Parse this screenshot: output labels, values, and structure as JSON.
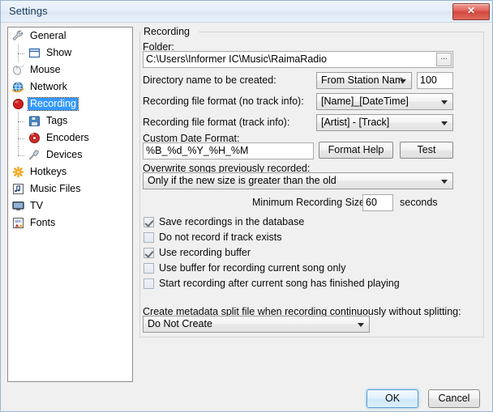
{
  "window": {
    "title": "Settings",
    "close_label": "✕"
  },
  "sidebar": {
    "items": [
      {
        "label": "General",
        "icon": "wrench-icon",
        "level": 0,
        "selected": false
      },
      {
        "label": "Show",
        "icon": "window-icon",
        "level": 1,
        "selected": false
      },
      {
        "label": "Mouse",
        "icon": "mouse-icon",
        "level": 0,
        "selected": false
      },
      {
        "label": "Network",
        "icon": "network-globe-icon",
        "level": 0,
        "selected": false
      },
      {
        "label": "Recording",
        "icon": "record-circle-icon",
        "level": 0,
        "selected": true
      },
      {
        "label": "Tags",
        "icon": "save-disk-icon",
        "level": 1,
        "selected": false
      },
      {
        "label": "Encoders",
        "icon": "disc-icon",
        "level": 1,
        "selected": false
      },
      {
        "label": "Devices",
        "icon": "microphone-icon",
        "level": 1,
        "selected": false
      },
      {
        "label": "Hotkeys",
        "icon": "asterisk-icon",
        "level": 0,
        "selected": false
      },
      {
        "label": "Music Files",
        "icon": "music-note-icon",
        "level": 0,
        "selected": false
      },
      {
        "label": "TV",
        "icon": "monitor-icon",
        "level": 0,
        "selected": false
      },
      {
        "label": "Fonts",
        "icon": "font-abc-icon",
        "level": 0,
        "selected": false
      }
    ]
  },
  "main": {
    "group_title": "Recording",
    "folder": {
      "label": "Folder:",
      "value": "C:\\Users\\Informer IC\\Music\\RaimaRadio",
      "browse_label": "..."
    },
    "directory_name": {
      "label": "Directory name to be created:",
      "selected": "From Station Nam",
      "count_value": "100"
    },
    "format_no_track": {
      "label": "Recording file format (no track info):",
      "selected": "[Name]_[DateTime]"
    },
    "format_track": {
      "label": "Recording file format (track info):",
      "selected": "[Artist] - [Track]"
    },
    "custom_date": {
      "label": "Custom Date Format:",
      "value": "%B_%d_%Y_%H_%M",
      "help_label": "Format Help",
      "test_label": "Test"
    },
    "overwrite": {
      "label": "Overwrite songs previously recorded:",
      "selected": "Only if the new size is greater than the old"
    },
    "minimum_size": {
      "label": "Minimum Recording Size:",
      "value": "60",
      "unit": "seconds"
    },
    "checkboxes": [
      {
        "label": "Save recordings in the database",
        "checked": true
      },
      {
        "label": "Do not record if track exists",
        "checked": false
      },
      {
        "label": "Use recording buffer",
        "checked": true
      },
      {
        "label": "Use buffer for recording current song only",
        "checked": false
      },
      {
        "label": "Start recording after current song has finished playing",
        "checked": false
      }
    ],
    "metadata_split": {
      "label": "Create metadata split file when recording continuously without splitting:",
      "selected": "Do Not Create"
    }
  },
  "footer": {
    "ok_label": "OK",
    "cancel_label": "Cancel"
  },
  "colors": {
    "selection": "#3399ff",
    "title_text": "#17385c",
    "close_red": "#d2483e",
    "dialog_bg": "#f0f0f0"
  }
}
